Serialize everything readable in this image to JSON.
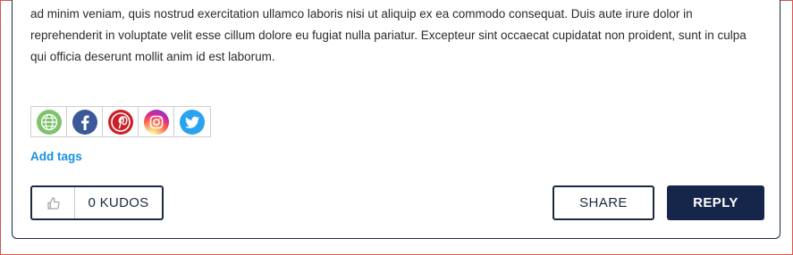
{
  "post": {
    "body_text": "ad minim veniam, quis nostrud exercitation ullamco laboris nisi ut aliquip ex ea commodo consequat. Duis aute irure dolor in reprehenderit in voluptate velit esse cillum dolore eu fugiat nulla pariatur. Excepteur sint occaecat cupidatat non proident, sunt in culpa qui officia deserunt mollit anim id est laborum."
  },
  "share_icons": [
    {
      "name": "globe-icon",
      "color": "#7dc36b"
    },
    {
      "name": "facebook-icon",
      "color": "#3b5998"
    },
    {
      "name": "pinterest-icon",
      "color": "#cb2027"
    },
    {
      "name": "instagram-icon",
      "color": "#d6249f"
    },
    {
      "name": "twitter-icon",
      "color": "#2aa3ef"
    }
  ],
  "tags": {
    "add_label": "Add tags"
  },
  "kudos": {
    "count_label": "0 KUDOS"
  },
  "actions": {
    "share_label": "SHARE",
    "reply_label": "REPLY"
  },
  "colors": {
    "accent": "#1a8fe3",
    "navy": "#15264a",
    "border": "#1c2a3f"
  }
}
